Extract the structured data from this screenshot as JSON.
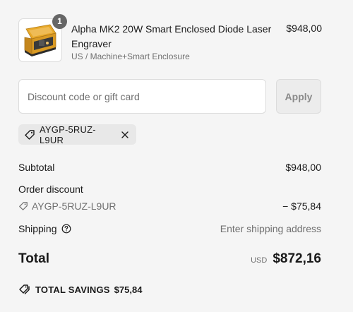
{
  "product": {
    "quantity": "1",
    "title": "Alpha MK2 20W Smart Enclosed Diode Laser Engraver",
    "variant": "US / Machine+Smart Enclosure",
    "price": "$948,00",
    "image_icon": "laser-engraver-product-image"
  },
  "discount": {
    "placeholder": "Discount code or gift card",
    "value": "",
    "apply_label": "Apply",
    "applied_code": "AYGP-5RUZ-L9UR"
  },
  "summary": {
    "subtotal_label": "Subtotal",
    "subtotal_value": "$948,00",
    "order_discount_label": "Order discount",
    "discount_code": "AYGP-5RUZ-L9UR",
    "discount_value": "− $75,84",
    "shipping_label": "Shipping",
    "shipping_value": "Enter shipping address",
    "total_label": "Total",
    "total_currency": "USD",
    "total_value": "$872,16",
    "savings_label": "TOTAL SAVINGS",
    "savings_value": "$75,84"
  },
  "colors": {
    "background": "#f5f5f5",
    "text": "#1a1a1a",
    "muted": "#707070",
    "chip_bg": "#e8e8e8",
    "badge": "#666666"
  }
}
